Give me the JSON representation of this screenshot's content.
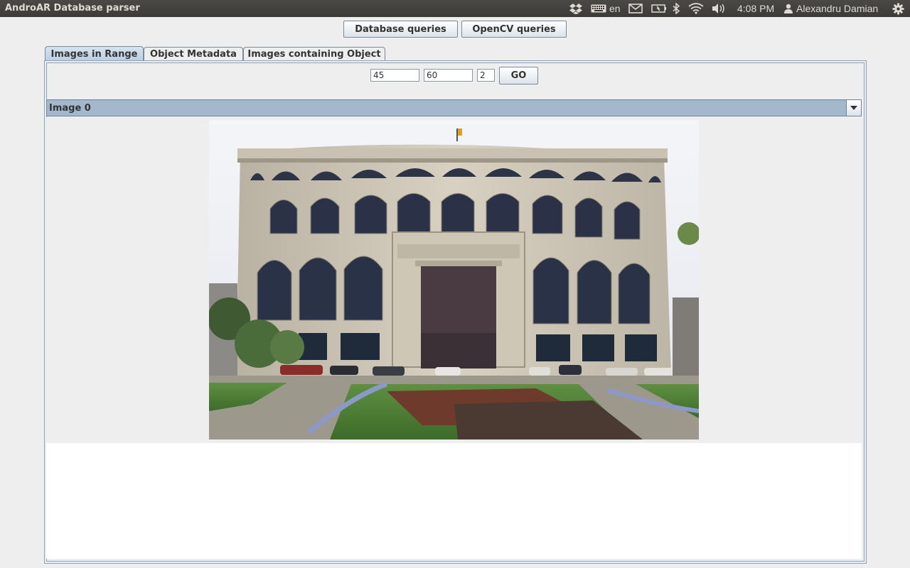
{
  "window": {
    "title": "AndroAR Database parser"
  },
  "tray": {
    "keyboard_layout": "en",
    "time": "4:08 PM",
    "user": "Alexandru Damian",
    "icons": [
      "dropbox-icon",
      "keyboard-icon",
      "mail-icon",
      "battery-icon",
      "bluetooth-icon",
      "wifi-icon",
      "volume-icon",
      "user-icon",
      "gear-icon"
    ]
  },
  "toolbar": {
    "database_label": "Database queries",
    "opencv_label": "OpenCV queries"
  },
  "tabs": [
    {
      "label": "Images in Range",
      "active": true
    },
    {
      "label": "Object Metadata",
      "active": false
    },
    {
      "label": "Images containing Object",
      "active": false
    }
  ],
  "range_form": {
    "from_value": "45",
    "to_value": "60",
    "count_value": "2",
    "go_label": "GO"
  },
  "image_selector": {
    "selected": "Image 0"
  },
  "photo": {
    "subject": "building-photo"
  },
  "colors": {
    "panel_bg": "#3c3b37",
    "accent": "#a3b8cc",
    "window_bg": "#eeeeee"
  }
}
